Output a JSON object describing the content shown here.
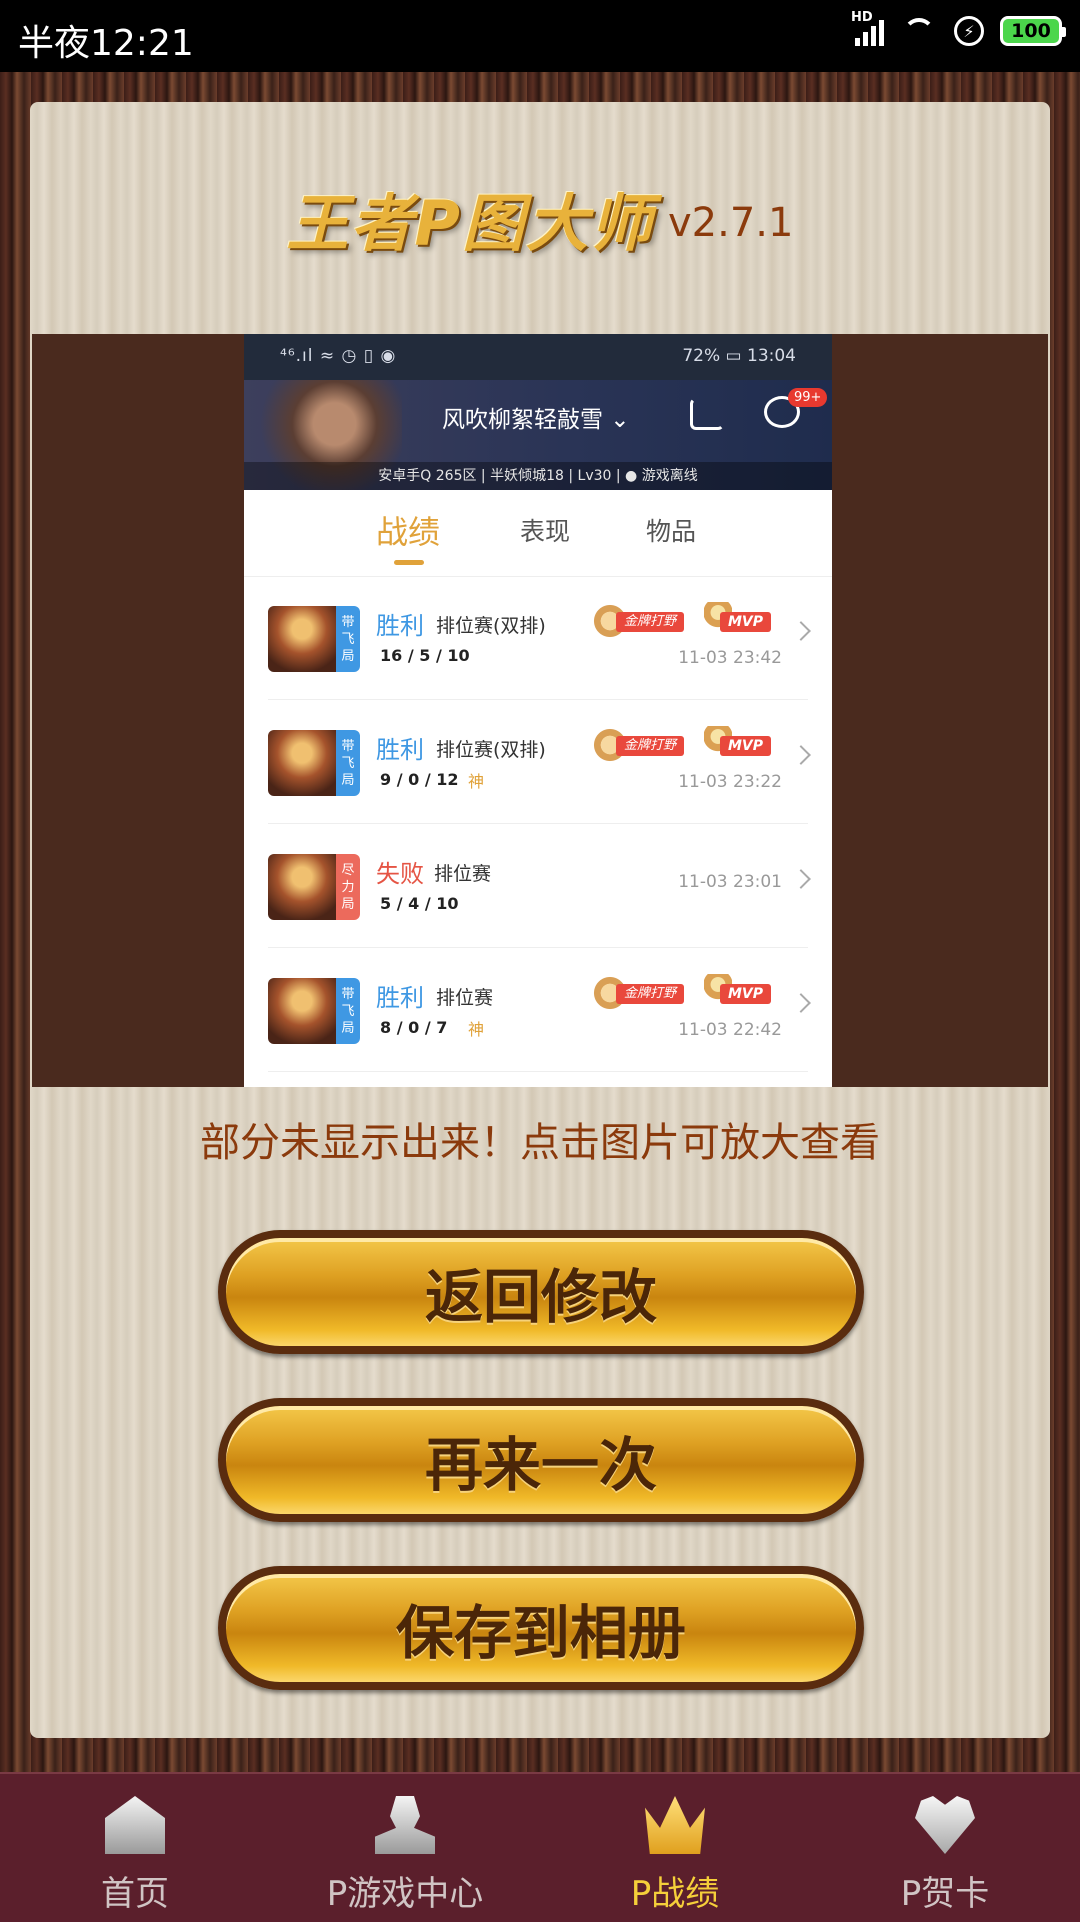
{
  "status_bar": {
    "time": "半夜12:21",
    "battery": "100",
    "network": "HD"
  },
  "header": {
    "logo_text": "王者P图大师",
    "version": "v2.7.1"
  },
  "preview": {
    "status": {
      "left_icons": "⁴⁶.ıl ≈ ◷ ▯ ◉",
      "battery": "72%",
      "time": "13:04"
    },
    "player_name": "风吹柳絮轻敲雪",
    "chat_badge": "99+",
    "meta": "安卓手Q 265区 | 半妖倾城18 | Lv30 | ● 游戏离线",
    "tabs": [
      "战绩",
      "表现",
      "物品"
    ],
    "matches": [
      {
        "tag": "带飞局",
        "result": "胜利",
        "mode": "排位赛(双排)",
        "kda": "16 / 5 / 10",
        "shen": "",
        "medal": "金牌打野",
        "mvp": "MVP",
        "time": "11-03 23:42"
      },
      {
        "tag": "带飞局",
        "result": "胜利",
        "mode": "排位赛(双排)",
        "kda": "9 / 0 / 12",
        "shen": "神",
        "medal": "金牌打野",
        "mvp": "MVP",
        "time": "11-03 23:22"
      },
      {
        "tag": "尽力局",
        "result": "失败",
        "mode": "排位赛",
        "kda": "5 / 4 / 10",
        "shen": "",
        "medal": "",
        "mvp": "",
        "time": "11-03 23:01"
      },
      {
        "tag": "带飞局",
        "result": "胜利",
        "mode": "排位赛",
        "kda": "8 / 0 / 7",
        "shen": "神",
        "medal": "金牌打野",
        "mvp": "MVP",
        "time": "11-03 22:42"
      }
    ]
  },
  "hint": "部分未显示出来！点击图片可放大查看",
  "buttons": {
    "edit": "返回修改",
    "again": "再来一次",
    "save": "保存到相册"
  },
  "tabbar": [
    {
      "label": "首页",
      "icon": "home-icon"
    },
    {
      "label": "P游戏中心",
      "icon": "user-icon"
    },
    {
      "label": "P战绩",
      "icon": "crown-icon"
    },
    {
      "label": "P贺卡",
      "icon": "heart-icon"
    }
  ],
  "colors": {
    "accent_gold": "#e0a23a",
    "win_blue": "#3f98e3",
    "lose_red": "#e55444",
    "tabbar_bg": "#5b1f2c",
    "active_tab": "#f5cf3a"
  }
}
